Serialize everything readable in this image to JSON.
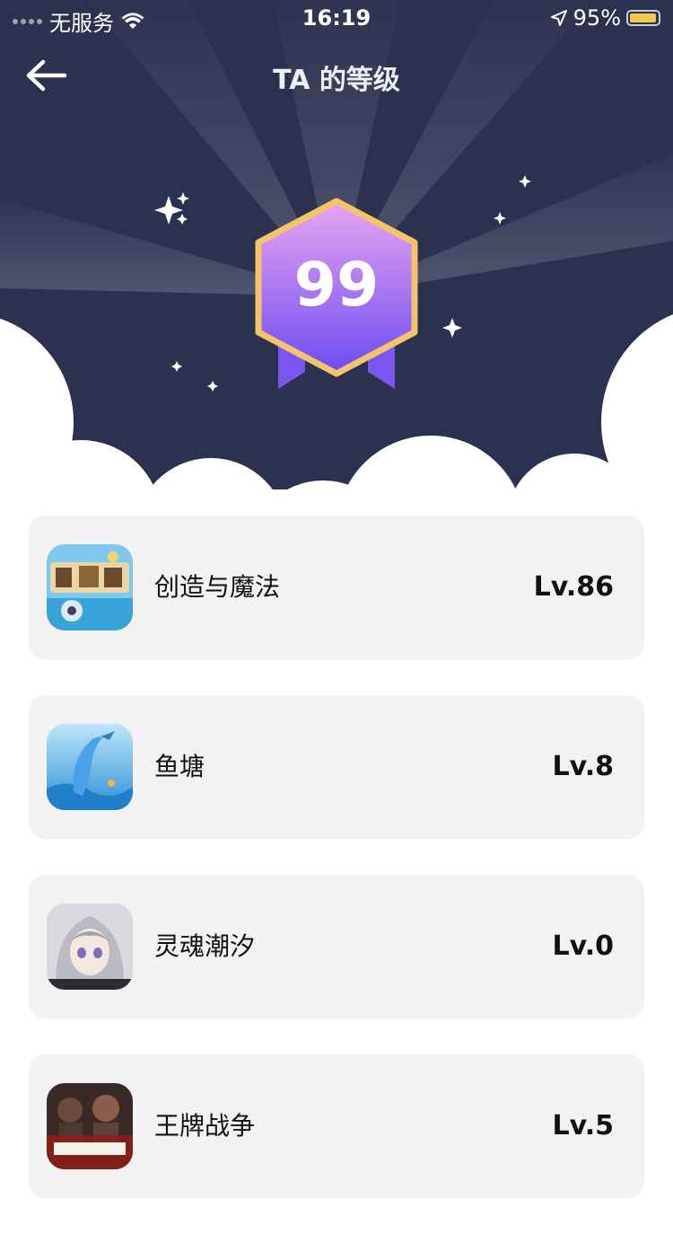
{
  "status_bar": {
    "carrier": "无服务",
    "time": "16:19",
    "battery": "95%",
    "battery_level": 0.95,
    "battery_color": "#f7c948"
  },
  "nav": {
    "title": "TA 的等级",
    "back_icon": "arrow-left-icon"
  },
  "badge": {
    "level": "99"
  },
  "colors": {
    "hero_bg": "#2d3150",
    "card_bg": "#f2f2f3",
    "badge_gradient_top": "#e8a6f0",
    "badge_gradient_bottom": "#6d4cf2",
    "badge_border": "#f3c46a",
    "ribbon": "#7a56ee"
  },
  "games": [
    {
      "name": "创造与魔法",
      "level": "Lv.86",
      "icon": "creation-magic-game-icon"
    },
    {
      "name": "鱼塘",
      "level": "Lv.8",
      "icon": "fish-pond-game-icon"
    },
    {
      "name": "灵魂潮汐",
      "level": "Lv.0",
      "icon": "soul-tide-game-icon"
    },
    {
      "name": "王牌战争",
      "level": "Lv.5",
      "icon": "ace-war-game-icon"
    }
  ]
}
